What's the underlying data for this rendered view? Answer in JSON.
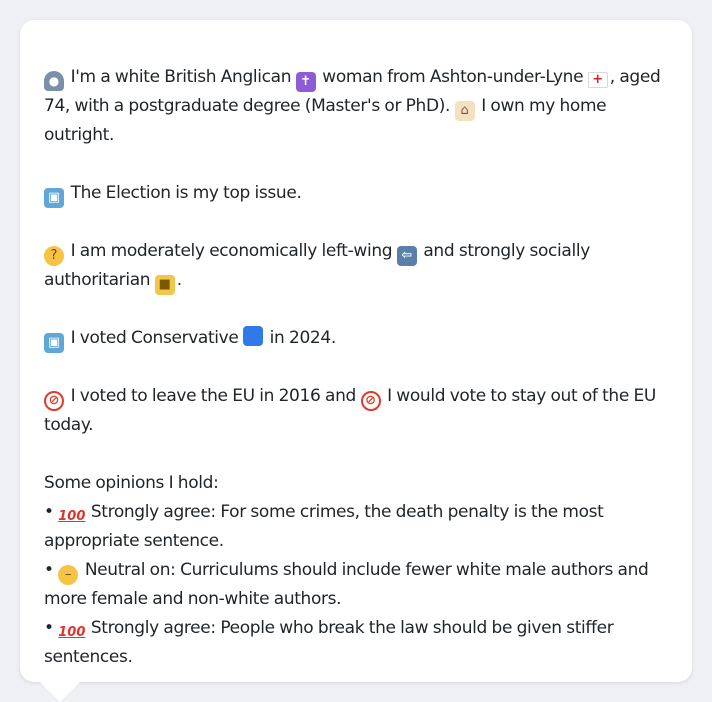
{
  "icons": {
    "person": "bust-in-silhouette",
    "cross": "latin-cross",
    "flag": "england-flag",
    "house": "house",
    "ballot": "ballot-box",
    "thinking": "thinking-face",
    "left_arrow": "left-arrow",
    "lock": "locked",
    "blue_square": "blue-square",
    "prohibited": "prohibited",
    "hundred": "hundred-points",
    "neutral": "neutral-face"
  },
  "glyphs": {
    "person": "●",
    "cross": "✝",
    "flag": "+",
    "house": "⌂",
    "ballot": "▣",
    "thinking": "?",
    "left_arrow": "⇦",
    "lock": "■",
    "prohibited": "⊘",
    "hundred": "100",
    "neutral": "–"
  },
  "profile": {
    "intro_a": "I'm a white British Anglican",
    "intro_b": "woman from Ashton-under-Lyne",
    "intro_c": ", aged 74, with a postgraduate degree (Master's or PhD).",
    "intro_d": "I own my home outright.",
    "top_issue": "The Election is my top issue.",
    "econ_a": "I am moderately economically left-wing",
    "econ_b": "and strongly socially authoritarian",
    "econ_c": ".",
    "vote_a": "I voted Conservative",
    "vote_b": "in 2024.",
    "eu_a": "I voted to leave the EU in 2016 and",
    "eu_b": "I would vote to stay out of the EU today.",
    "opinions_heading": "Some opinions I hold:",
    "bullet": "•",
    "opinions": [
      {
        "stance": "Strongly agree:",
        "text": "For some crimes, the death penalty is the most appropriate sentence."
      },
      {
        "stance": "Neutral on:",
        "text": "Curriculums should include fewer white male authors and more female and non-white authors."
      },
      {
        "stance": "Strongly agree:",
        "text": "People who break the law should be given stiffer sentences."
      }
    ]
  }
}
